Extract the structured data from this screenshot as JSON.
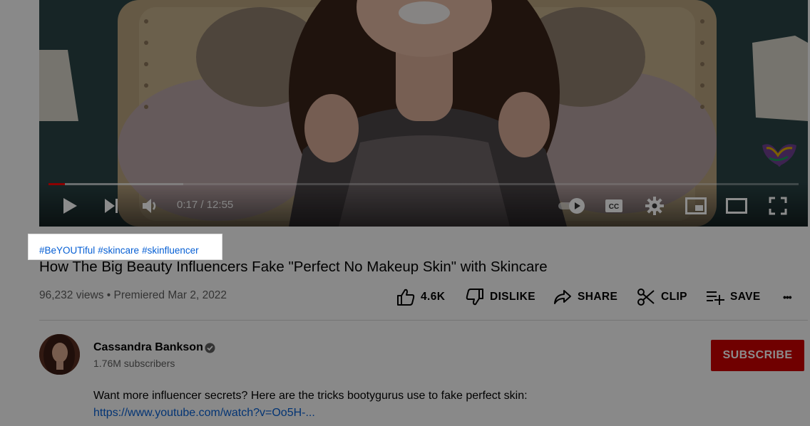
{
  "player": {
    "time_current": "0:17",
    "time_separator": " / ",
    "time_total": "12:55",
    "progress_fraction": 0.022,
    "buffered_fraction": 0.18,
    "autoplay_on": true,
    "icons": [
      "play-icon",
      "next-icon",
      "volume-icon",
      "autoplay-toggle-icon",
      "captions-icon",
      "settings-icon",
      "miniplayer-icon",
      "theater-icon",
      "fullscreen-icon"
    ]
  },
  "video": {
    "hashtags": [
      "#BeYOUTiful",
      "#skincare",
      "#skinfluencer"
    ],
    "title": "How The Big Beauty Influencers Fake \"Perfect No Makeup Skin\" with Skincare",
    "views": "96,232 views",
    "separator": " • ",
    "premiered": "Premiered Mar 2, 2022"
  },
  "actions": {
    "like": "4.6K",
    "dislike": "DISLIKE",
    "share": "SHARE",
    "clip": "CLIP",
    "save": "SAVE",
    "more": "•••"
  },
  "channel": {
    "name": "Cassandra Bankson",
    "subscribers": "1.76M subscribers",
    "subscribe_label": "SUBSCRIBE"
  },
  "description": {
    "text": "Want more influencer secrets? Here are the tricks bootygurus use to fake perfect skin:",
    "link": "https://www.youtube.com/watch?v=Oo5H-..."
  },
  "colors": {
    "accent_red": "#cc0000",
    "progress_red": "#ff0000",
    "link_blue": "#065fd4"
  }
}
